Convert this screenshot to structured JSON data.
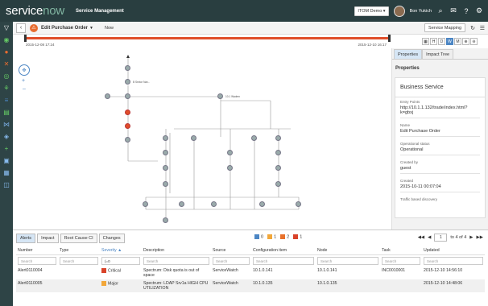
{
  "topbar": {
    "logo_a": "service",
    "logo_b": "now",
    "app": "Service Management",
    "user": "Bon Yukich",
    "context": "ITOM Demo"
  },
  "sub": {
    "title": "Edit Purchase Order",
    "now_label": "Now",
    "mapping": "Service Mapping"
  },
  "timeline": {
    "start": "2015-12-08 17:24",
    "end": "2015-12-10 16:17"
  },
  "zoom": [
    "H",
    "D",
    "W",
    "M"
  ],
  "rp": {
    "tabs": [
      "Properties",
      "Impact Tree"
    ],
    "header": "Properties",
    "card_title": "Business Service",
    "fields": [
      {
        "label": "Entry Points",
        "value": "http://10.1.1.132/trade/index.html?k=gbxj"
      },
      {
        "label": "Name",
        "value": "Edit Purchase Order"
      },
      {
        "label": "Operational status",
        "value": "Operational"
      },
      {
        "label": "Created by",
        "value": "guest"
      },
      {
        "label": "Created",
        "value": "2015-10-11 00:07:04"
      },
      {
        "label": "Traffic based discovery",
        "value": ""
      }
    ]
  },
  "bottom": {
    "tabs": [
      "Alerts",
      "Impact",
      "Root Cause CI",
      "Changes"
    ],
    "sev_counts": [
      "0",
      "1",
      "2",
      "1"
    ],
    "sev_colors": [
      "#4c86c4",
      "#f2a73a",
      "#e8712b",
      "#d9432a"
    ],
    "page": "1",
    "of": "to 4 of 4",
    "columns": [
      "Number",
      "Type",
      "Severity ▲",
      "Description",
      "Source",
      "Configuration item",
      "Node",
      "Task",
      "Updated"
    ],
    "filters": [
      "Search",
      "Search",
      "(=0",
      "Search",
      "Search",
      "Search",
      "Search",
      "Search",
      "Search"
    ],
    "rows": [
      {
        "number": "Alert0110004",
        "type": "",
        "severity": "Critical",
        "sev_color": "#d9432a",
        "description": "Spectrum: Disk quota is out of space",
        "source": "ServiceWatch",
        "ci": "10.1.0.141",
        "node": "10.1.0.141",
        "task": "INC0010001",
        "updated": "2015-12-10 14:56:10"
      },
      {
        "number": "Alert0110005",
        "type": "",
        "severity": "Major",
        "sev_color": "#f2a73a",
        "description": "Spectrum: LDAP Srv1a HIGH CPU UTILIZATION",
        "source": "ServiceWatch",
        "ci": "10.1.0.135",
        "node": "10.1.0.135",
        "task": "",
        "updated": "2015-12-10 14:48:06"
      }
    ]
  }
}
